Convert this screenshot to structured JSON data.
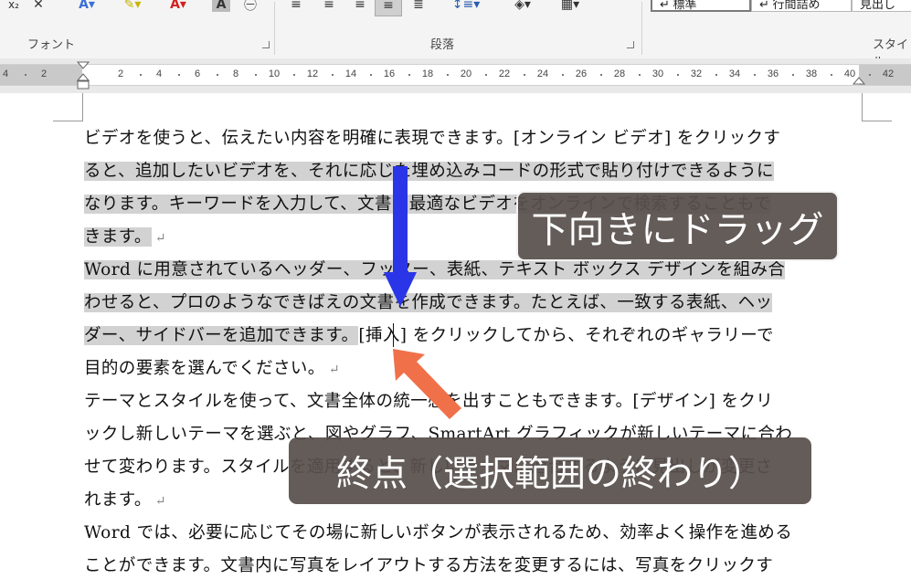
{
  "ribbon": {
    "groups": {
      "font": "フォント",
      "paragraph": "段落",
      "styles": "スタイル"
    },
    "styles_gallery": {
      "normal": "↵ 標準",
      "no_spacing": "↵ 行間詰め",
      "heading": "見出し"
    }
  },
  "ruler": {
    "numbers": [
      "4",
      "2",
      "2",
      "4",
      "6",
      "8",
      "10",
      "12",
      "14",
      "16",
      "18",
      "20",
      "22",
      "24",
      "26",
      "28",
      "30",
      "32",
      "34",
      "36",
      "38",
      "40",
      "42"
    ]
  },
  "document": {
    "lines": [
      "ビデオを使うと、伝えたい内容を明確に表現できます。[オンライン ビデオ] をクリックす",
      "ると、追加したいビデオを、それに応じた埋め込みコードの形式で貼り付けできるように",
      "なります。キーワードを入力して、文書に最適なビデオをオンラインで検索することもで",
      "きます。",
      "Word に用意されているヘッダー、フッター、表紙、テキスト ボックス デザインを組み合",
      "わせると、プロのようなできばえの文書を作成できます。たとえば、一致する表紙、ヘッ",
      "ダー、サイドバーを追加できます。",
      "[挿入] をクリックしてから、それぞれのギャラリーで",
      "目的の要素を選んでください。",
      "テーマとスタイルを使って、文書全体の統一感を出すこともできます。[デザイン] をクリ",
      "ックし新しいテーマを選ぶと、図やグラフ、SmartArt グラフィックが新しいテーマに合わ",
      "せて変わります。スタイルを適用すると、新しいテーマに適合するように見出しが変更さ",
      "れます。",
      "Word では、必要に応じてその場に新しいボタンが表示されるため、効率よく操作を進める",
      "ことができます。文書内に写真をレイアウトする方法を変更するには、写真をクリックす"
    ],
    "paragraph_mark": "↵"
  },
  "annotations": {
    "drag_down": "下向きにドラッグ",
    "end_point": "終点（選択範囲の終わり）",
    "arrow_down_color": "#2b35e8",
    "arrow_end_color": "#f0704a"
  }
}
